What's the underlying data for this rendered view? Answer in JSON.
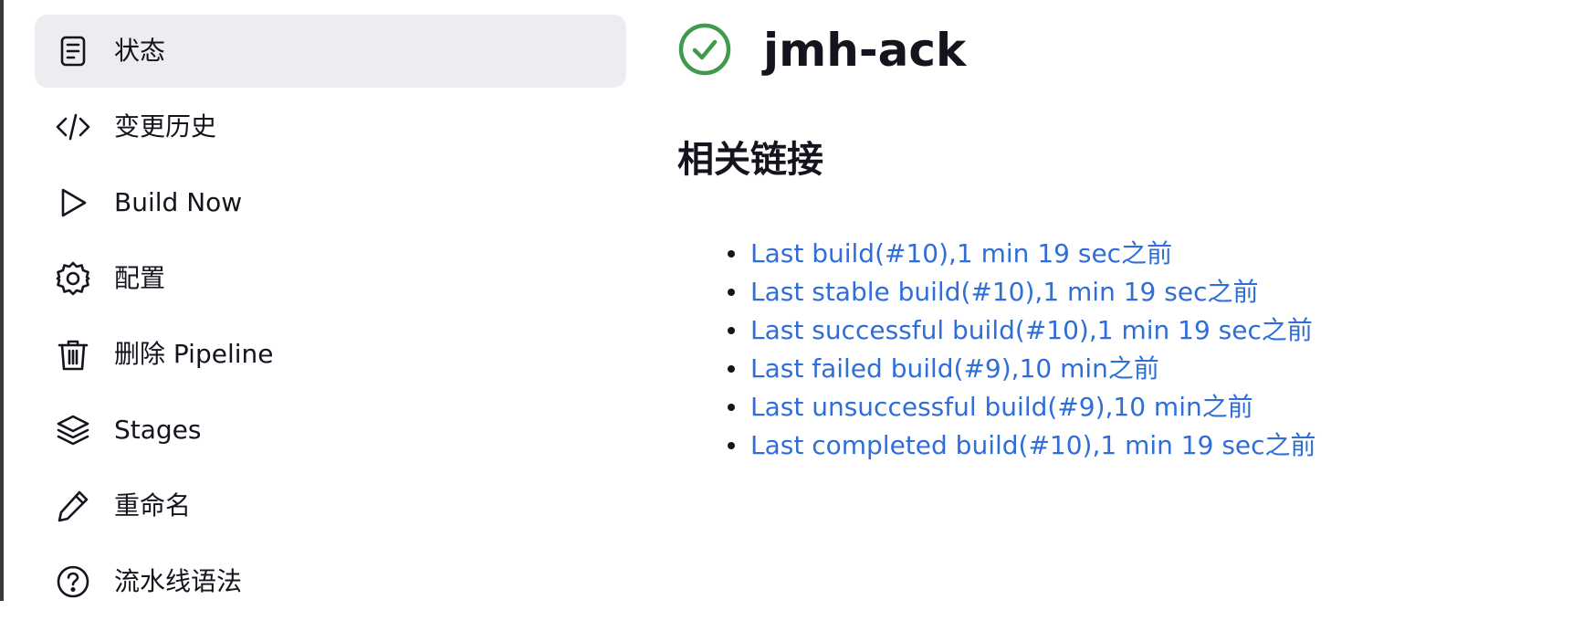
{
  "sidebar": {
    "items": [
      {
        "label": "状态",
        "icon": "document-icon",
        "active": true
      },
      {
        "label": "变更历史",
        "icon": "code-icon",
        "active": false
      },
      {
        "label": "Build Now",
        "icon": "play-icon",
        "active": false
      },
      {
        "label": "配置",
        "icon": "gear-icon",
        "active": false
      },
      {
        "label": "删除 Pipeline",
        "icon": "trash-icon",
        "active": false
      },
      {
        "label": "Stages",
        "icon": "layers-icon",
        "active": false
      },
      {
        "label": "重命名",
        "icon": "pencil-icon",
        "active": false
      },
      {
        "label": "流水线语法",
        "icon": "help-circle-icon",
        "active": false
      }
    ]
  },
  "main": {
    "status_icon": "check-circle-icon",
    "status_color": "#3f9b4b",
    "job_title": "jmh-ack",
    "section_title": "相关链接",
    "links": [
      "Last build(#10),1 min 19 sec之前",
      "Last stable build(#10),1 min 19 sec之前",
      "Last successful build(#10),1 min 19 sec之前",
      "Last failed build(#9),10 min之前",
      "Last unsuccessful build(#9),10 min之前",
      "Last completed build(#10),1 min 19 sec之前"
    ]
  },
  "colors": {
    "link": "#2f6ed8",
    "active_bg": "#ededf1",
    "text": "#14141f"
  }
}
